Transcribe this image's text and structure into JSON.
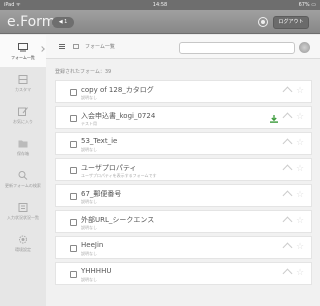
{
  "status": {
    "left": "iPad ᯤ",
    "time": "14:58",
    "right": "67% ▭"
  },
  "header": {
    "title": "e.Form",
    "back_label": "◀ 1",
    "logout_label": "ログアウト",
    "settings_icon": "gear-icon"
  },
  "sidebar": {
    "items": [
      {
        "label": "フォーム一覧",
        "icon": "tray-icon",
        "active": true
      },
      {
        "label": "カスタマ",
        "icon": "grid-icon",
        "active": false
      },
      {
        "label": "お気に入り",
        "icon": "edit-icon",
        "active": false
      },
      {
        "label": "保存箱",
        "icon": "folder-icon",
        "active": false
      },
      {
        "label": "更新フォームの検索",
        "icon": "search-icon",
        "active": false
      },
      {
        "label": "入力状況状況一覧",
        "icon": "list-icon",
        "active": false
      },
      {
        "label": "環境設定",
        "icon": "gear-icon",
        "active": false
      }
    ]
  },
  "toolbar": {
    "breadcrumb": "フォーム一覧",
    "search_placeholder": ""
  },
  "main": {
    "count_label": "登録されたフォーム：39",
    "forms": [
      {
        "name": "copy of 128_カタログ",
        "desc": "説明なし",
        "downloaded": false
      },
      {
        "name": "入会申込書_kogi_0724",
        "desc": "テスト用",
        "downloaded": true
      },
      {
        "name": "53_Text_ie",
        "desc": "説明なし",
        "downloaded": false
      },
      {
        "name": "ユーザプロパティ",
        "desc": "ユーザプロパティを表示するフォームです",
        "downloaded": false
      },
      {
        "name": "67_郵便番号",
        "desc": "説明なし",
        "downloaded": false
      },
      {
        "name": "外部URL_シークエンス",
        "desc": "説明なし",
        "downloaded": false
      },
      {
        "name": "HeeJin",
        "desc": "説明なし",
        "downloaded": false
      },
      {
        "name": "YHHHHU",
        "desc": "説明なし",
        "downloaded": false
      }
    ]
  },
  "colors": {
    "accent_download": "#3a9a3a",
    "nav_bg": "#8e8e8e"
  }
}
